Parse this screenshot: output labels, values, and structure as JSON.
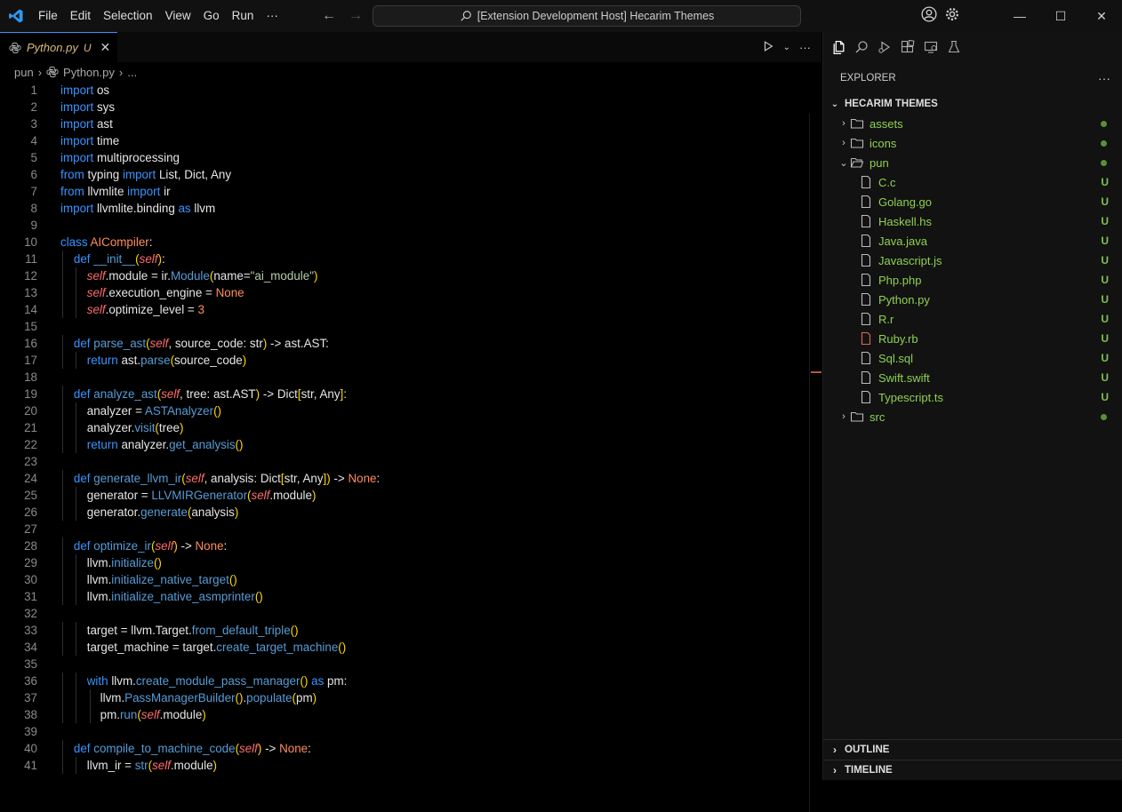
{
  "menu": [
    "File",
    "Edit",
    "Selection",
    "View",
    "Go",
    "Run",
    "···"
  ],
  "search": {
    "text": "[Extension Development Host] Hecarim Themes"
  },
  "tab": {
    "name": "Python.py",
    "status": "U"
  },
  "breadcrumb": {
    "folder": "pun",
    "file": "Python.py",
    "more": "..."
  },
  "explorer": {
    "title": "EXPLORER",
    "root": "HECARIM THEMES",
    "items": [
      {
        "label": "assets",
        "kind": "folder",
        "decoration": ""
      },
      {
        "label": "icons",
        "kind": "folder",
        "decoration": ""
      },
      {
        "label": "pun",
        "kind": "folder-open",
        "decoration": ""
      },
      {
        "label": "C.c",
        "kind": "file",
        "decoration": "U"
      },
      {
        "label": "Golang.go",
        "kind": "file",
        "decoration": "U"
      },
      {
        "label": "Haskell.hs",
        "kind": "file",
        "decoration": "U"
      },
      {
        "label": "Java.java",
        "kind": "file",
        "decoration": "U"
      },
      {
        "label": "Javascript.js",
        "kind": "file",
        "decoration": "U"
      },
      {
        "label": "Php.php",
        "kind": "file",
        "decoration": "U"
      },
      {
        "label": "Python.py",
        "kind": "file",
        "decoration": "U"
      },
      {
        "label": "R.r",
        "kind": "file",
        "decoration": "U"
      },
      {
        "label": "Ruby.rb",
        "kind": "file",
        "decoration": "U"
      },
      {
        "label": "Sql.sql",
        "kind": "file",
        "decoration": "U"
      },
      {
        "label": "Swift.swift",
        "kind": "file",
        "decoration": "U"
      },
      {
        "label": "Typescript.ts",
        "kind": "file",
        "decoration": "U"
      },
      {
        "label": "src",
        "kind": "folder",
        "decoration": ""
      }
    ]
  },
  "panels": {
    "outline": "OUTLINE",
    "timeline": "TIMELINE"
  },
  "code": {
    "line_numbers": [
      "1",
      "2",
      "3",
      "4",
      "5",
      "6",
      "7",
      "8",
      "9",
      "10",
      "11",
      "12",
      "13",
      "14",
      "15",
      "16",
      "17",
      "18",
      "19",
      "20",
      "21",
      "22",
      "23",
      "24",
      "25",
      "26",
      "27",
      "28",
      "29",
      "30",
      "31",
      "32",
      "33",
      "34",
      "35",
      "36",
      "37",
      "38",
      "39",
      "40",
      "41"
    ],
    "lines": [
      "import os",
      "import sys",
      "import ast",
      "import time",
      "import multiprocessing",
      "from typing import List, Dict, Any",
      "from llvmlite import ir",
      "import llvmlite.binding as llvm",
      "",
      "class AICompiler:",
      "    def __init__(self):",
      "        self.module = ir.Module(name=\"ai_module\")",
      "        self.execution_engine = None",
      "        self.optimize_level = 3",
      "",
      "    def parse_ast(self, source_code: str) -> ast.AST:",
      "        return ast.parse(source_code)",
      "",
      "    def analyze_ast(self, tree: ast.AST) -> Dict[str, Any]:",
      "        analyzer = ASTAnalyzer()",
      "        analyzer.visit(tree)",
      "        return analyzer.get_analysis()",
      "",
      "    def generate_llvm_ir(self, analysis: Dict[str, Any]) -> None:",
      "        generator = LLVMIRGenerator(self.module)",
      "        generator.generate(analysis)",
      "",
      "    def optimize_ir(self) -> None:",
      "        llvm.initialize()",
      "        llvm.initialize_native_target()",
      "        llvm.initialize_native_asmprinter()",
      "",
      "        target = llvm.Target.from_default_triple()",
      "        target_machine = target.create_target_machine()",
      "",
      "        with llvm.create_module_pass_manager() as pm:",
      "            llvm.PassManagerBuilder().populate(pm)",
      "            pm.run(self.module)",
      "",
      "    def compile_to_machine_code(self) -> None:",
      "        llvm_ir = str(self.module)"
    ]
  }
}
